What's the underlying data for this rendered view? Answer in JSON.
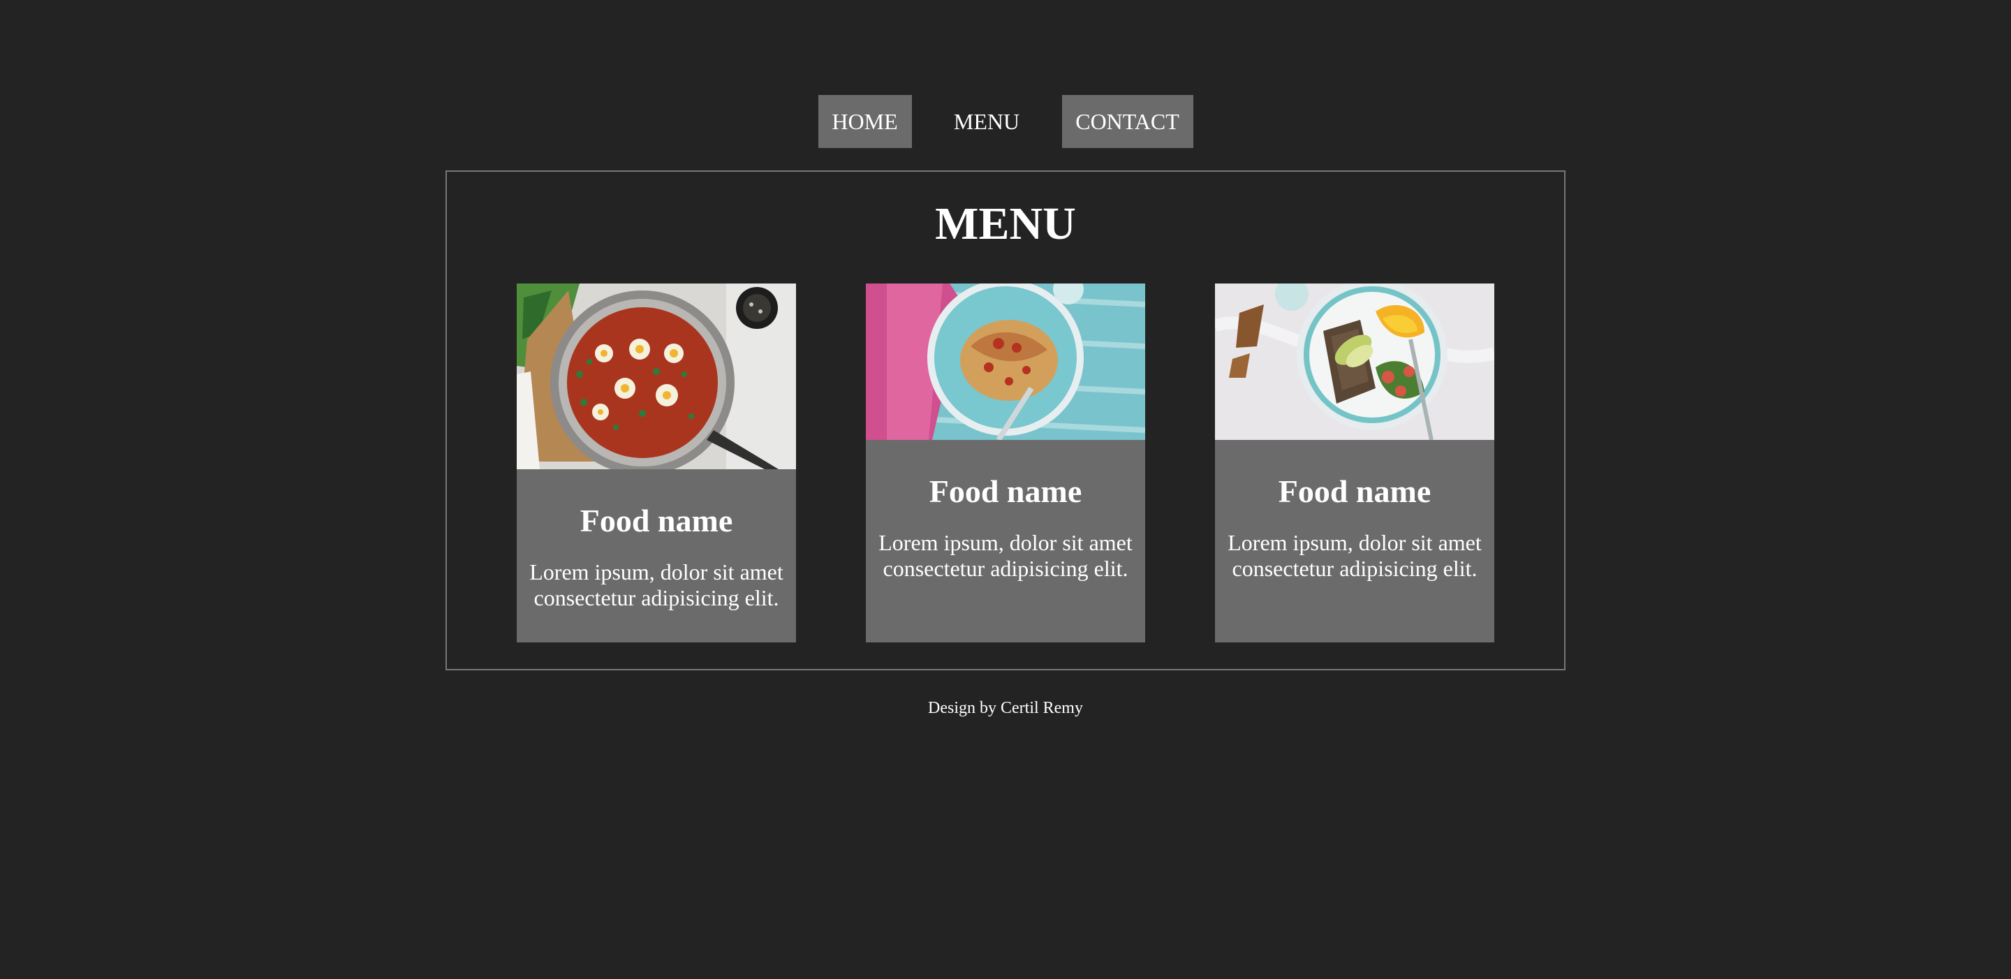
{
  "nav": {
    "items": [
      {
        "label": "HOME"
      },
      {
        "label": "MENU"
      },
      {
        "label": "CONTACT"
      }
    ]
  },
  "menu": {
    "title": "MENU",
    "cards": [
      {
        "image": "shakshuka-pan-image",
        "title": "Food name",
        "description": "Lorem ipsum, dolor sit amet consectetur adipisicing elit."
      },
      {
        "image": "spaghetti-plate-image",
        "title": "Food name",
        "description": "Lorem ipsum, dolor sit amet consectetur adipisicing elit."
      },
      {
        "image": "avocado-salad-bowl-image",
        "title": "Food name",
        "description": "Lorem ipsum, dolor sit amet consectetur adipisicing elit."
      }
    ]
  },
  "footer": {
    "credit": "Design by Certil Remy"
  },
  "colors": {
    "background": "#232323",
    "panel": "#6b6b6b",
    "border": "#777777",
    "text": "#ffffff"
  }
}
